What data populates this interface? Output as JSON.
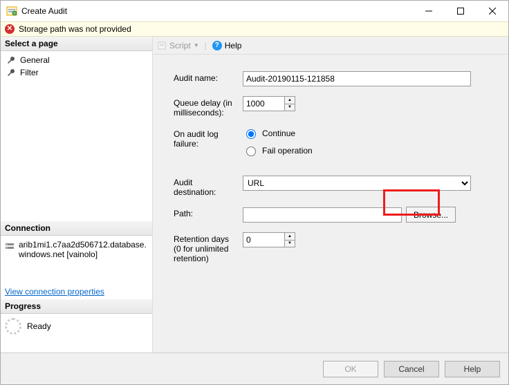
{
  "window": {
    "title": "Create Audit"
  },
  "error": {
    "text": "Storage path was not provided"
  },
  "left": {
    "select_page_header": "Select a page",
    "nav": {
      "general": "General",
      "filter": "Filter"
    },
    "connection_header": "Connection",
    "connection_line1": "arib1mi1.c7aa2d506712.database.",
    "connection_line2": "windows.net [vainolo]",
    "view_props_link": "View connection properties",
    "progress_header": "Progress",
    "progress_status": "Ready"
  },
  "toolbar": {
    "script": "Script",
    "help": "Help"
  },
  "form": {
    "audit_name_label": "Audit name:",
    "audit_name_value": "Audit-20190115-121858",
    "queue_delay_label": "Queue delay (in milliseconds):",
    "queue_delay_value": "1000",
    "on_failure_label": "On audit log failure:",
    "on_failure_options": {
      "continue": "Continue",
      "fail": "Fail operation"
    },
    "audit_dest_label": "Audit destination:",
    "audit_dest_value": "URL",
    "path_label": "Path:",
    "path_value": "",
    "browse_label": "Browse...",
    "retention_label": "Retention days (0 for unlimited retention)",
    "retention_value": "0"
  },
  "footer": {
    "ok": "OK",
    "cancel": "Cancel",
    "help": "Help"
  }
}
